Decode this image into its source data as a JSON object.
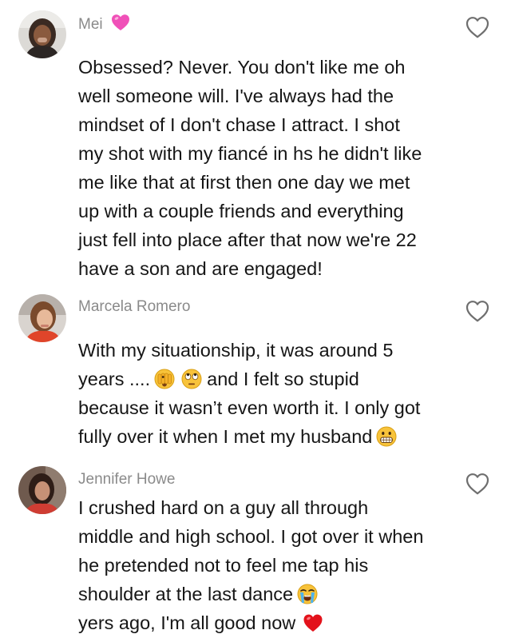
{
  "comments": [
    {
      "username": "Mei",
      "username_emoji": "pink-heart-emoji",
      "lines": [
        "Obsessed? Never. You don't like me oh",
        "well someone will. I've always had the",
        "mindset of I don't chase I attract. I shot",
        "my shot with my fiancé in hs he didn't like",
        "me like that at first then one day we met",
        "up with a couple friends and everything",
        "just fell into place after that now we're 22",
        "have a son and are engaged!"
      ]
    },
    {
      "username": "Marcela Romero",
      "lines": [
        "With my situationship, it was around 5",
        "years ....",
        "and I felt so stupid",
        "because it wasn’t even worth it. I only got",
        "fully over it when I met my husband"
      ],
      "emojis": [
        "face-with-peeking-eye-emoji",
        "face-with-rolling-eyes-emoji",
        "grimacing-face-emoji"
      ]
    },
    {
      "username": "Jennifer Howe",
      "lines": [
        "I crushed hard on a guy all through",
        "middle and high school. I got over it when",
        "he pretended not to feel me tap his",
        "shoulder at the last dance",
        "yers ago, I'm all good now"
      ],
      "emojis": [
        "loudly-crying-face-emoji",
        "red-heart-emoji"
      ]
    }
  ],
  "colors": {
    "username": "#8a8a8a",
    "text": "#161616",
    "like_outline": "#6e6e6e",
    "background": "#ffffff"
  },
  "icons": {
    "like": "heart-outline-icon"
  }
}
